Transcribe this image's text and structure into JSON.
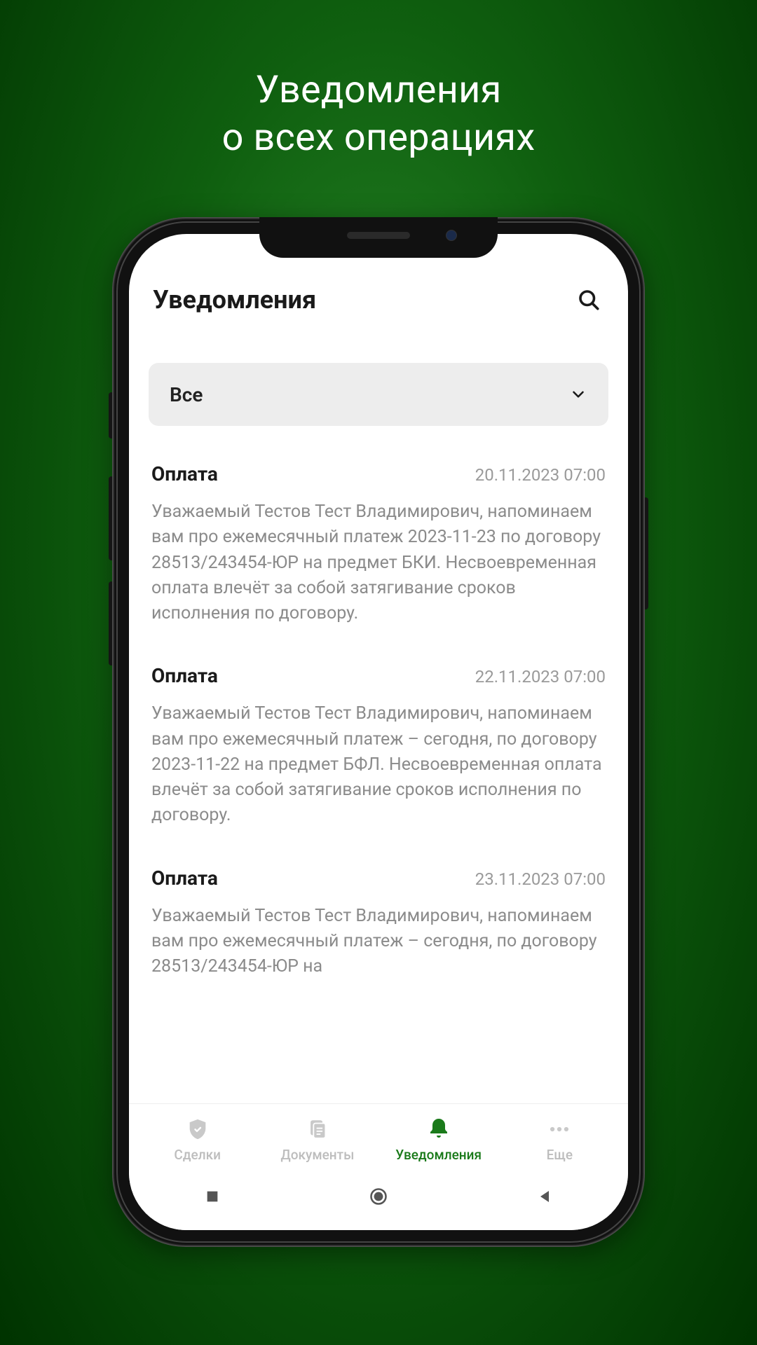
{
  "promo": {
    "line1": "Уведомления",
    "line2": "о всех операциях"
  },
  "header": {
    "title": "Уведомления"
  },
  "filter": {
    "selected": "Все"
  },
  "notifications": [
    {
      "title": "Оплата",
      "date": "20.11.2023 07:00",
      "body": "Уважаемый Тестов Тест Владимирович, напоминаем вам про ежемесячный платеж 2023-11-23 по договору 28513/243454-ЮР на предмет БКИ. Несвоевременная оплата влечёт за собой затягивание сроков исполнения по договору."
    },
    {
      "title": "Оплата",
      "date": "22.11.2023 07:00",
      "body": "Уважаемый Тестов Тест Владимирович, напоминаем вам про ежемесячный платеж – сегодня, по договору 2023-11-22 на предмет БФЛ. Несвоевременная оплата влечёт за собой затягивание сроков исполнения по договору."
    },
    {
      "title": "Оплата",
      "date": "23.11.2023 07:00",
      "body": "Уважаемый Тестов Тест Владимирович, напоминаем вам про ежемесячный платеж – сегодня, по договору 28513/243454-ЮР на"
    }
  ],
  "nav": {
    "deals": "Сделки",
    "documents": "Документы",
    "notifications": "Уведомления",
    "more": "Еще"
  },
  "colors": {
    "accent": "#1a7a1a"
  }
}
